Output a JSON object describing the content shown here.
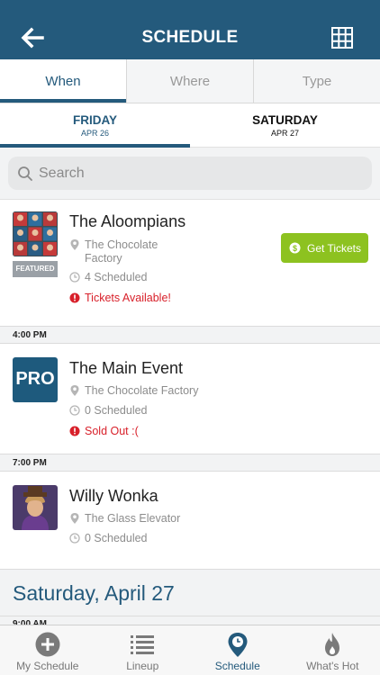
{
  "header": {
    "title": "SCHEDULE",
    "back_icon": "arrow-left-icon",
    "grid_icon": "grid-icon"
  },
  "view_tabs": [
    {
      "label": "When",
      "active": true
    },
    {
      "label": "Where",
      "active": false
    },
    {
      "label": "Type",
      "active": false
    }
  ],
  "day_tabs": [
    {
      "day": "FRIDAY",
      "date": "APR 26",
      "active": true
    },
    {
      "day": "SATURDAY",
      "date": "APR 27",
      "active": false
    }
  ],
  "search": {
    "placeholder": "Search",
    "value": ""
  },
  "events": [
    {
      "name": "The Aloompians",
      "venue": "The Chocolate Factory",
      "scheduled": "4 Scheduled",
      "status": "Tickets Available!",
      "badge": "FEATURED",
      "button": "Get Tickets"
    },
    {
      "time": "4:00 PM",
      "name": "The Main Event",
      "venue": "The Chocolate Factory",
      "scheduled": "0 Scheduled",
      "status": "Sold Out :(",
      "thumb_text": "PRO"
    },
    {
      "time": "7:00 PM",
      "name": "Willy Wonka",
      "venue": "The Glass Elevator",
      "scheduled": "0 Scheduled"
    }
  ],
  "day_section": {
    "title": "Saturday, April 27",
    "partial_time": "9:00 AM"
  },
  "tabbar": [
    {
      "label": "My Schedule",
      "icon": "plus-circle-icon",
      "active": false
    },
    {
      "label": "Lineup",
      "icon": "list-icon",
      "active": false
    },
    {
      "label": "Schedule",
      "icon": "map-pin-icon",
      "active": true
    },
    {
      "label": "What's Hot",
      "icon": "flame-icon",
      "active": false
    }
  ],
  "colors": {
    "brand": "#245a7c",
    "tickets_button": "#8dc220",
    "alert": "#d8202a"
  }
}
